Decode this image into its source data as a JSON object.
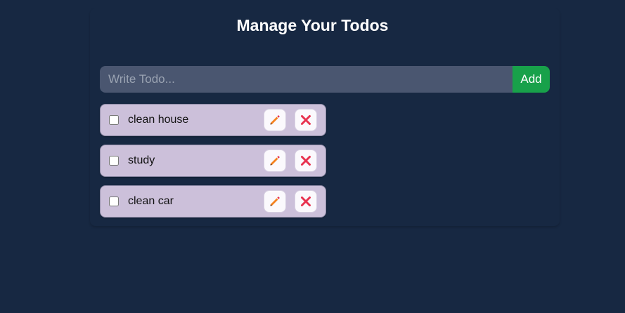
{
  "header": {
    "title": "Manage Your Todos"
  },
  "form": {
    "placeholder": "Write Todo...",
    "value": "",
    "add_label": "Add"
  },
  "todos": [
    {
      "text": "clean house",
      "completed": false
    },
    {
      "text": "study",
      "completed": false
    },
    {
      "text": "clean car",
      "completed": false
    }
  ],
  "icons": {
    "edit": "pencil-icon",
    "delete": "close-icon"
  },
  "colors": {
    "background": "#172842",
    "input_bg": "#4a5670",
    "add_button": "#18a14a",
    "todo_bg": "#ccc0da",
    "pencil": "#f58220",
    "delete": "#e8314f"
  }
}
